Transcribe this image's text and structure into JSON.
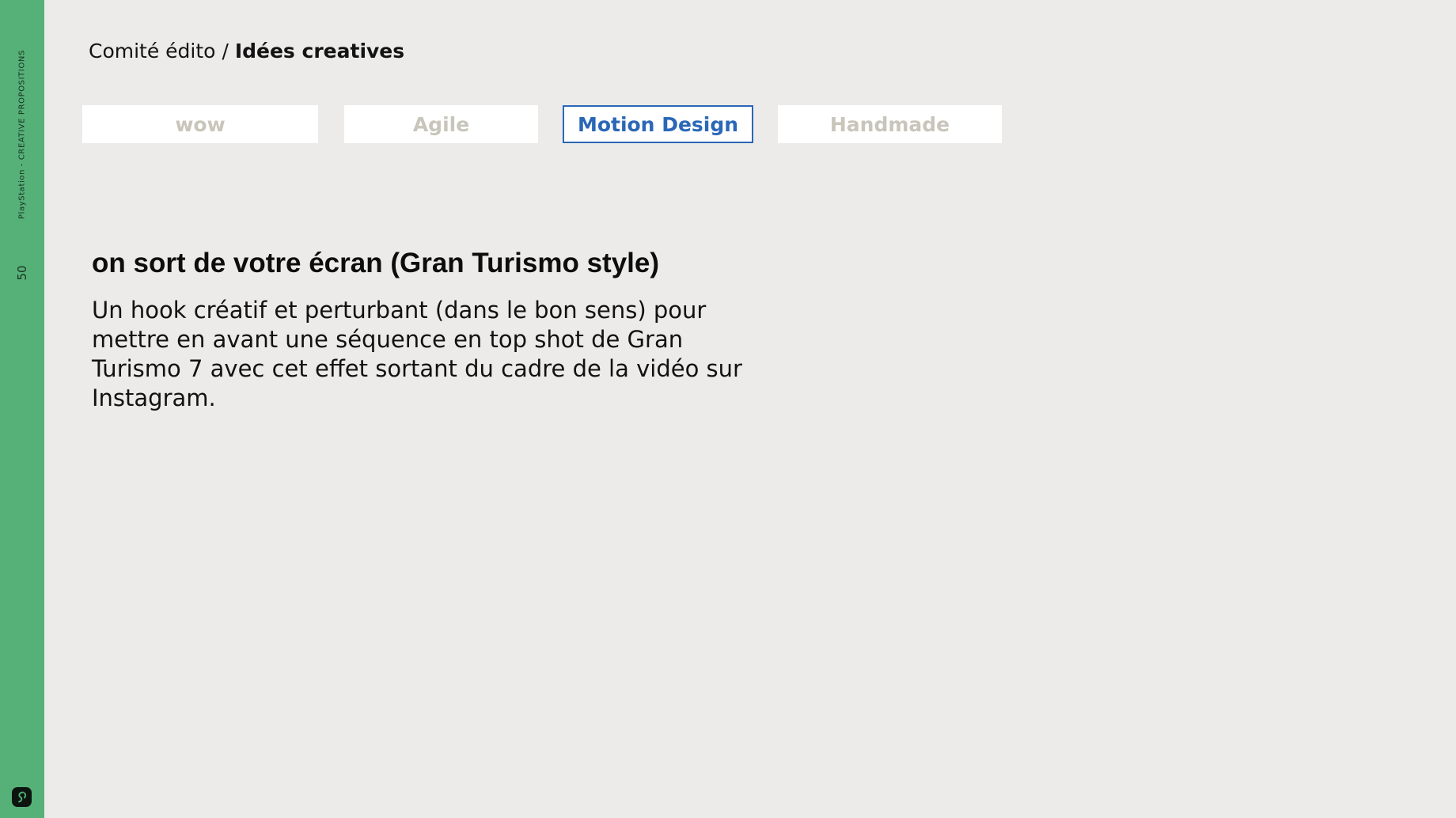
{
  "sidebar": {
    "caption": "PlayStation - CREATIVE PROPOSITIONS",
    "page_number": "50",
    "logo_icon": "hub-logo-icon"
  },
  "breadcrumb": {
    "parent": "Comité édito",
    "separator": "/",
    "current": "Idées creatives"
  },
  "tags": [
    {
      "label": "wow",
      "active": false
    },
    {
      "label": "Agile",
      "active": false
    },
    {
      "label": "Motion Design",
      "active": true
    },
    {
      "label": "Handmade",
      "active": false
    }
  ],
  "idea": {
    "title": "on sort de votre écran (Gran Turismo style)",
    "description": "Un hook créatif et perturbant (dans le bon sens) pour mettre en avant une séquence en top shot de Gran Turismo 7 avec cet effet sortant du cadre de la vidéo sur Instagram."
  },
  "colors": {
    "sidebar": "#56b178",
    "background": "#ecebe9",
    "active_tag": "#2a67b6",
    "inactive_tag": "#c8c5bb"
  }
}
